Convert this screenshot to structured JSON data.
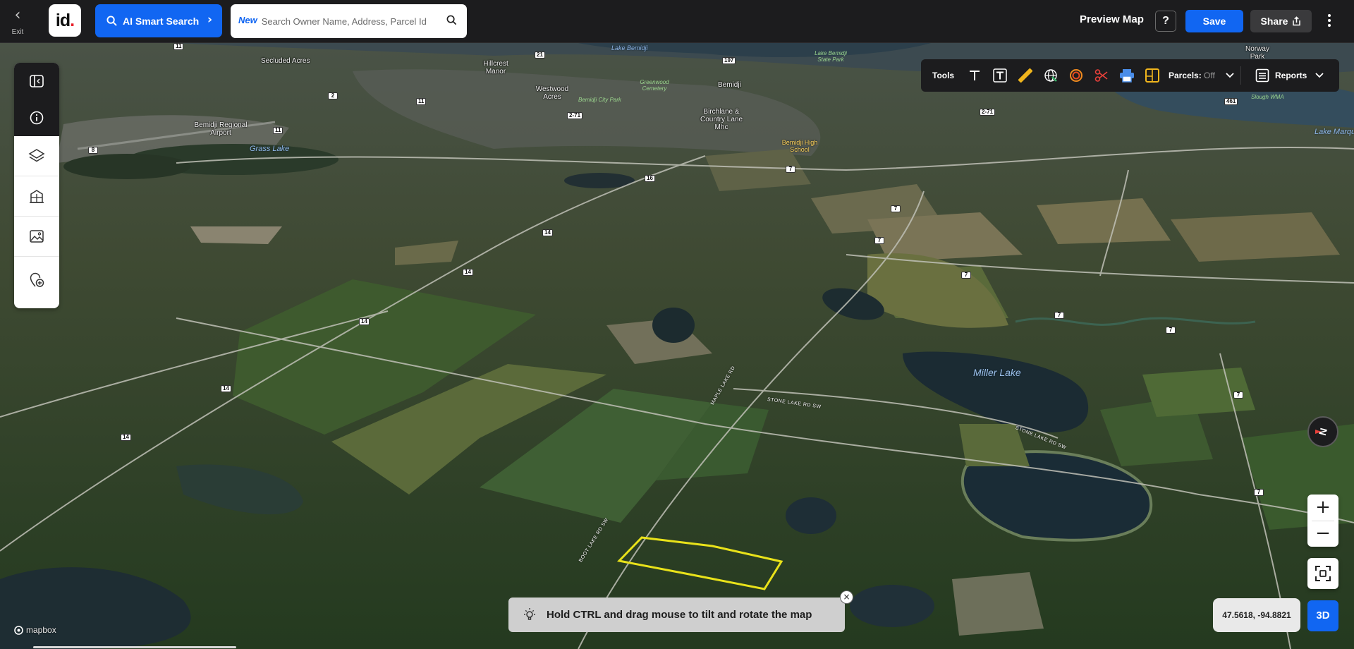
{
  "topbar": {
    "exit_label": "Exit",
    "logo_text": "id",
    "ai_search_label": "AI Smart Search",
    "search": {
      "new_badge": "New",
      "placeholder": "Search Owner Name, Address, Parcel Id"
    },
    "preview_label": "Preview Map",
    "help_label": "?",
    "save_label": "Save",
    "share_label": "Share"
  },
  "left_toolbar": {
    "icons": [
      "panel-toggle-icon",
      "info-icon",
      "layers-icon",
      "buildings-icon",
      "image-icon",
      "add-location-icon"
    ]
  },
  "tools": {
    "label": "Tools",
    "icons": [
      "text-icon",
      "text-box-icon",
      "ruler-icon",
      "globe-measure-icon",
      "radius-icon",
      "scissors-icon",
      "print-icon",
      "parcel-icon"
    ],
    "parcels_label": "Parcels:",
    "parcels_state": "Off",
    "reports_label": "Reports"
  },
  "map": {
    "place_labels": [
      "Secluded Acres",
      "Hillcrest Manor",
      "Westwood Acres",
      "Bemidji",
      "Birchlane & Country Lane Mhc",
      "Bemidji Regional Airport",
      "Norway Park"
    ],
    "water_labels": [
      "Lake Bemidji",
      "Grass Lake",
      "Lake Marque",
      "Miller Lake"
    ],
    "park_labels": [
      "Greenwood Cemetery",
      "Bemidji City Park",
      "Lake Bemidji State Park",
      "Slough WMA"
    ],
    "poi_labels": [
      "Bemidji High School"
    ],
    "road_labels": [
      "BOOT LAKE RD SW",
      "STONE LAKE RD SW",
      "STONE LAKE RD SW",
      "MAPLE LAKE RD"
    ],
    "route_shields": [
      "11",
      "21",
      "197",
      "2",
      "11",
      "2-71",
      "16",
      "14",
      "14",
      "14",
      "14",
      "7",
      "7",
      "7",
      "7",
      "7",
      "7",
      "7",
      "7",
      "2-71",
      "461",
      "11",
      "8"
    ],
    "parcel_highlight_color": "#e9e21a",
    "attribution": "mapbox"
  },
  "controls": {
    "zoom_in": "+",
    "zoom_out": "−",
    "mode_3d": "3D",
    "coordinates": "47.5618, -94.8821",
    "compass_letter": "N"
  },
  "tip": {
    "text": "Hold CTRL and drag mouse to tilt and rotate the map",
    "close": "×"
  }
}
